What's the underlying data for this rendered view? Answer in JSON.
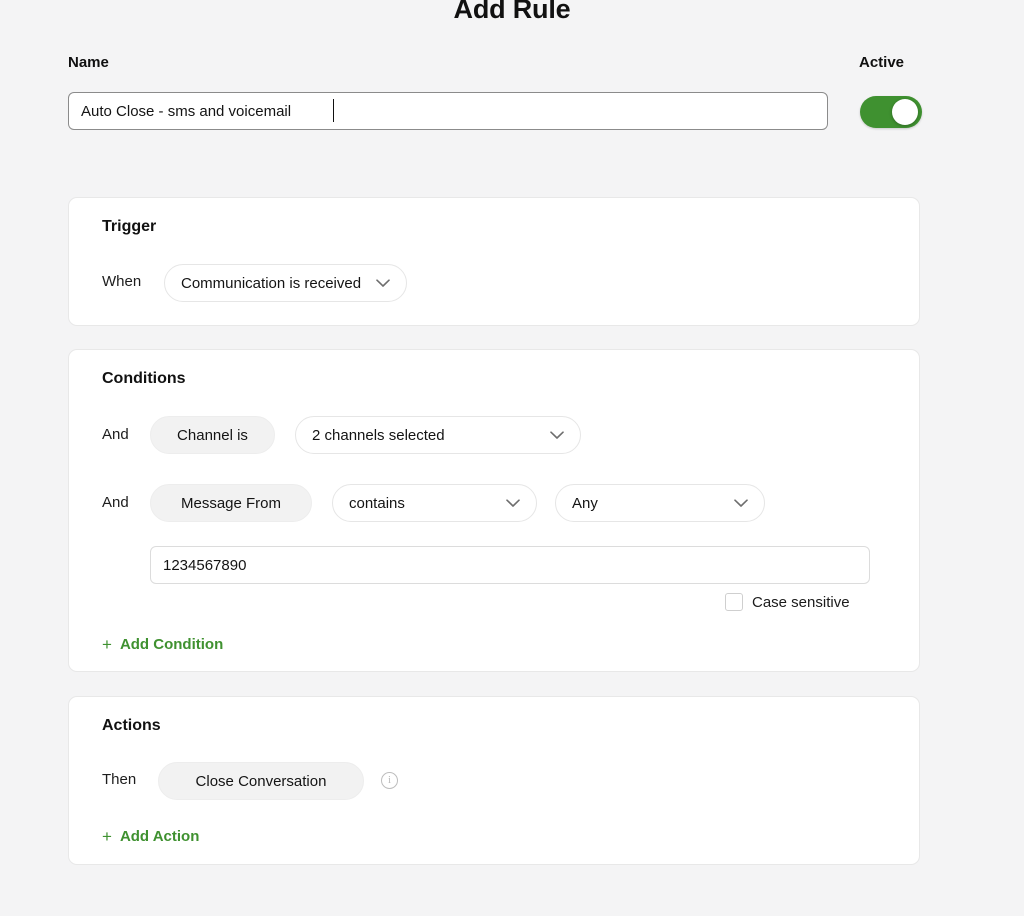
{
  "header": {
    "title": "Add Rule"
  },
  "name_section": {
    "label": "Name",
    "value": "Auto Close - sms and voicemail",
    "placeholder": "Name",
    "active_label": "Active",
    "active": true,
    "accent_color": "#3f9130"
  },
  "trigger": {
    "title": "Trigger",
    "prefix": "When",
    "event": "Communication is received"
  },
  "conditions": {
    "title": "Conditions",
    "rows": [
      {
        "prefix": "And",
        "field": "Channel is",
        "value": "2 channels selected"
      },
      {
        "prefix": "And",
        "field": "Message From",
        "operator": "contains",
        "match": "Any",
        "value": "1234567890",
        "case_sensitive_label": "Case sensitive",
        "case_sensitive": false
      }
    ],
    "add_label": "Add Condition",
    "add_plus": "+"
  },
  "actions": {
    "title": "Actions",
    "prefix": "Then",
    "action": "Close Conversation",
    "info_glyph": "i",
    "add_label": "Add Action",
    "add_plus": "+"
  }
}
